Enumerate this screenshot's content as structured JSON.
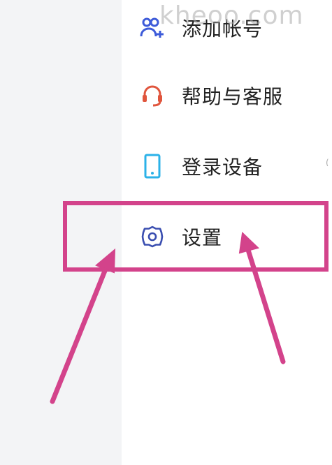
{
  "watermark": "kheoo.com",
  "menu": {
    "items": [
      {
        "label": "添加帐号",
        "icon": "add-account-icon",
        "color": "#3d5bd9"
      },
      {
        "label": "帮助与客服",
        "icon": "headset-icon",
        "color": "#e0553d"
      },
      {
        "label": "登录设备",
        "icon": "phone-icon",
        "color": "#2bb2e8"
      },
      {
        "label": "设置",
        "icon": "gear-icon",
        "color": "#3a4eb0"
      }
    ]
  },
  "annotation": {
    "highlight_color": "#d3438b",
    "arrow_color": "#d3438b"
  }
}
